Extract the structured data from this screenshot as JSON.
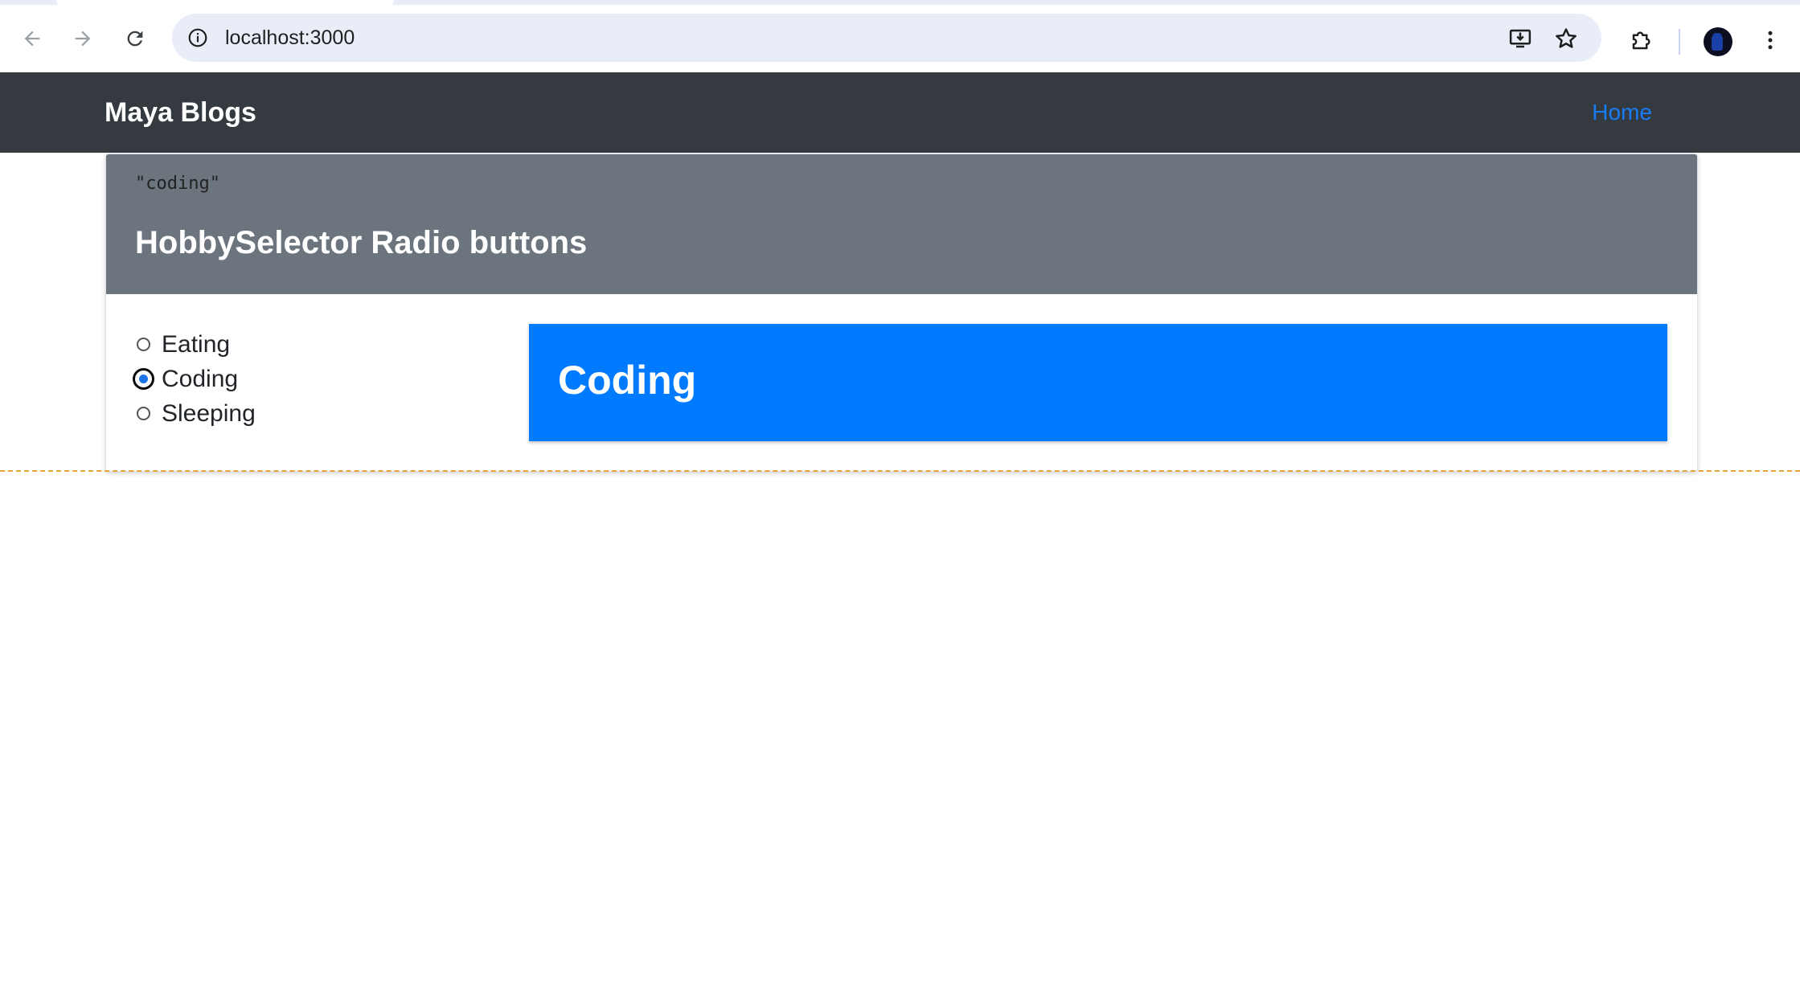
{
  "browser": {
    "url": "localhost:3000",
    "icons": {
      "back": "arrow-left-icon",
      "forward": "arrow-right-icon",
      "reload": "reload-icon",
      "site_info": "info-icon",
      "install": "install-app-icon",
      "bookmark": "star-icon",
      "extensions": "puzzle-icon",
      "profile": "avatar",
      "menu": "kebab-menu-icon"
    }
  },
  "navbar": {
    "brand": "Maya Blogs",
    "home_link": "Home",
    "background": "#343a40",
    "link_color": "#1a7cf5"
  },
  "card": {
    "state_value": "\"coding\"",
    "title": "HobbySelector Radio buttons",
    "header_background": "#6c757d",
    "options": [
      {
        "label": "Eating",
        "checked": false
      },
      {
        "label": "Coding",
        "checked": true
      },
      {
        "label": "Sleeping",
        "checked": false
      }
    ],
    "selected_display": "Coding",
    "selected_background": "#007bff"
  }
}
